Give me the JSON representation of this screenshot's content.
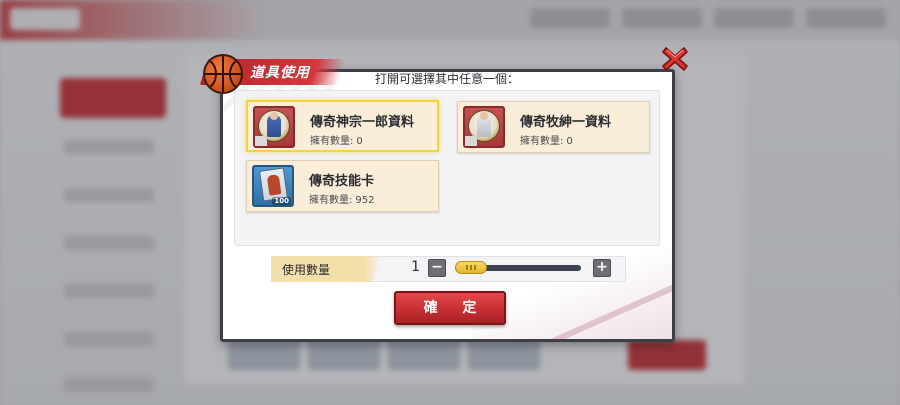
{
  "dialog": {
    "title": "道具使用",
    "instruction": "打開可選擇其中任意一個：",
    "confirm_label": "確 定"
  },
  "items": [
    {
      "name": "傳奇神宗一郎資料",
      "count_label": "擁有數量:",
      "count": "0",
      "icon": "legend-jin-soichiro-icon",
      "selected": true
    },
    {
      "name": "傳奇牧紳一資料",
      "count_label": "擁有數量:",
      "count": "0",
      "icon": "legend-maki-shinichi-icon",
      "selected": false
    },
    {
      "name": "傳奇技能卡",
      "count_label": "擁有數量:",
      "count": "952",
      "icon": "legend-skill-card-icon",
      "badge": "100",
      "selected": false
    }
  ],
  "quantity": {
    "label": "使用數量",
    "value": "1",
    "minus": "−",
    "plus": "+"
  },
  "colors": {
    "accent_red": "#c42d31",
    "selected_border": "#f3d53a",
    "card_bg": "#fbeed9",
    "slider_handle": "#e3b52a"
  }
}
